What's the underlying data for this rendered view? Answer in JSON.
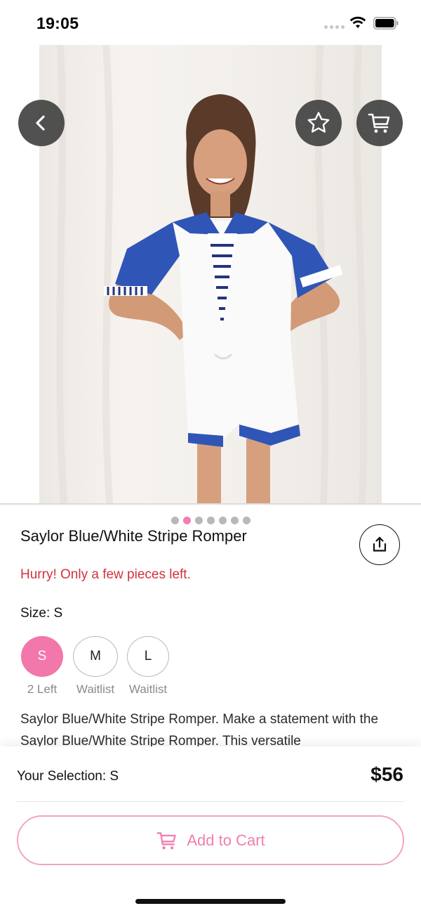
{
  "status_bar": {
    "time": "19:05"
  },
  "header": {
    "back_icon": "chevron-left-icon",
    "favorite_icon": "star-icon",
    "cart_icon": "cart-icon"
  },
  "gallery": {
    "page_count": 7,
    "active_index": 1
  },
  "product": {
    "title": "Saylor Blue/White Stripe Romper",
    "stock_note": "Hurry! Only a few pieces left.",
    "size_label": "Size: S",
    "sizes": [
      {
        "label": "S",
        "note": "2 Left",
        "selected": true
      },
      {
        "label": "M",
        "note": "Waitlist",
        "selected": false
      },
      {
        "label": "L",
        "note": "Waitlist",
        "selected": false
      }
    ],
    "description": "Saylor Blue/White Stripe Romper. Make a statement with the Saylor Blue/White Stripe Romper. This versatile"
  },
  "footer": {
    "selection_text": "Your Selection: S",
    "price": "$56",
    "add_to_cart_label": "Add to Cart"
  },
  "colors": {
    "accent_pink": "#f07fb0",
    "alert_red": "#d3313f",
    "button_dark": "#424242"
  }
}
